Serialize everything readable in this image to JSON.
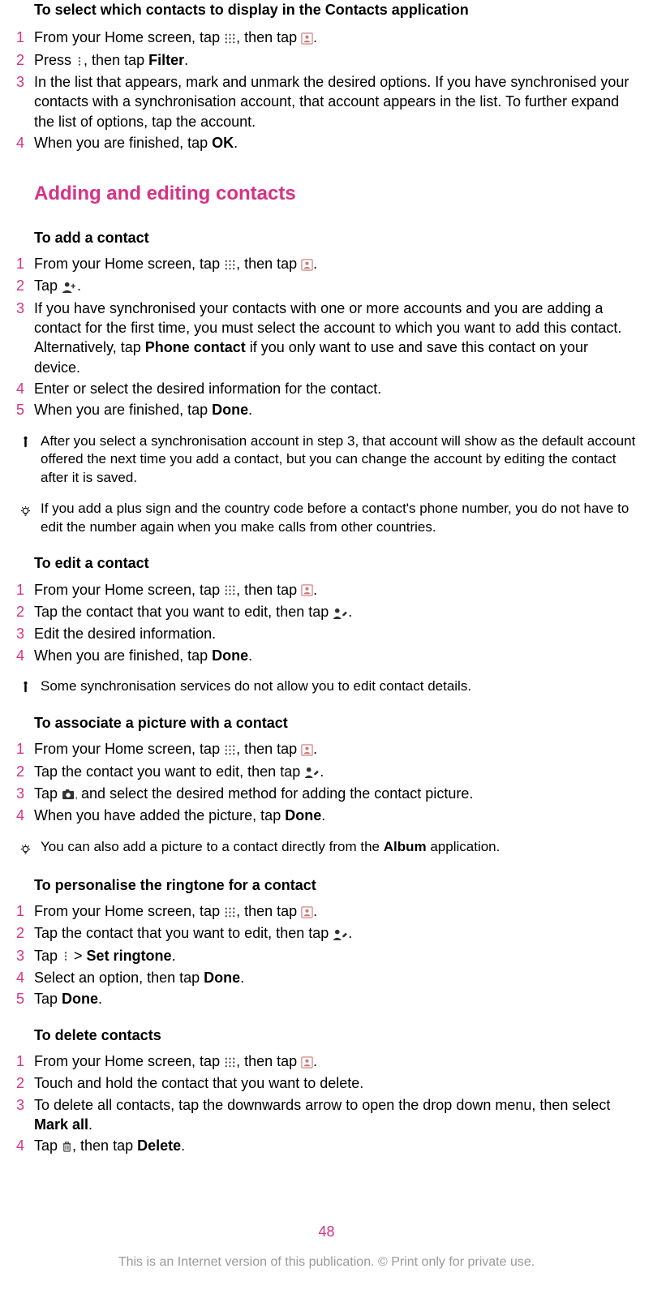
{
  "sec1": {
    "title": "To select which contacts to display in the Contacts application",
    "s1a": "From your Home screen, tap ",
    "s1b": ", then tap ",
    "s1c": ".",
    "s2a": "Press ",
    "s2b": ", then tap ",
    "s2_filter": "Filter",
    "s2c": ".",
    "s3": "In the list that appears, mark and unmark the desired options. If you have synchronised your contacts with a synchronisation account, that account appears in the list. To further expand the list of options, tap the account.",
    "s4a": "When you are finished, tap ",
    "s4_ok": "OK",
    "s4b": "."
  },
  "h2": "Adding and editing contacts",
  "sec2": {
    "title": "To add a contact",
    "s1a": "From your Home screen, tap ",
    "s1b": ", then tap ",
    "s1c": ".",
    "s2a": "Tap ",
    "s2b": ".",
    "s3a": "If you have synchronised your contacts with one or more accounts and you are adding a contact for the first time, you must select the account to which you want to add this contact. Alternatively, tap ",
    "s3_phone": "Phone contact",
    "s3b": " if you only want to use and save this contact on your device.",
    "s4": "Enter or select the desired information for the contact.",
    "s5a": "When you are finished, tap ",
    "s5_done": "Done",
    "s5b": ".",
    "note1": "After you select a synchronisation account in step 3, that account will show as the default account offered the next time you add a contact, but you can change the account by editing the contact after it is saved.",
    "tip1": "If you add a plus sign and the country code before a contact's phone number, you do not have to edit the number again when you make calls from other countries."
  },
  "sec3": {
    "title": "To edit a contact",
    "s1a": "From your Home screen, tap ",
    "s1b": ", then tap ",
    "s1c": ".",
    "s2a": "Tap the contact that you want to edit, then tap ",
    "s2b": ".",
    "s3": "Edit the desired information.",
    "s4a": "When you are finished, tap ",
    "s4_done": "Done",
    "s4b": ".",
    "note1": "Some synchronisation services do not allow you to edit contact details."
  },
  "sec4": {
    "title": "To associate a picture with a contact",
    "s1a": "From your Home screen, tap ",
    "s1b": ", then tap ",
    "s1c": ".",
    "s2a": "Tap the contact you want to edit, then tap ",
    "s2b": ".",
    "s3a": "Tap ",
    "s3b": " and select the desired method for adding the contact picture.",
    "s4a": "When you have added the picture, tap ",
    "s4_done": "Done",
    "s4b": ".",
    "tip1a": "You can also add a picture to a contact directly from the ",
    "tip1_album": "Album",
    "tip1b": " application."
  },
  "sec5": {
    "title": "To personalise the ringtone for a contact",
    "s1a": "From your Home screen, tap ",
    "s1b": ", then tap ",
    "s1c": ".",
    "s2a": "Tap the contact that you want to edit, then tap ",
    "s2b": ".",
    "s3a": "Tap ",
    "s3b": " > ",
    "s3_ring": "Set ringtone",
    "s3c": ".",
    "s4a": "Select an option, then tap ",
    "s4_done": "Done",
    "s4b": ".",
    "s5a": "Tap ",
    "s5_done": "Done",
    "s5b": "."
  },
  "sec6": {
    "title": "To delete contacts",
    "s1a": "From your Home screen, tap ",
    "s1b": ", then tap ",
    "s1c": ".",
    "s2": "Touch and hold the contact that you want to delete.",
    "s3a": "To delete all contacts, tap the downwards arrow to open the drop down menu, then select ",
    "s3_mark": "Mark all",
    "s3b": ".",
    "s4a": "Tap ",
    "s4b": ", then tap ",
    "s4_del": "Delete",
    "s4c": "."
  },
  "footer": {
    "page": "48",
    "text": "This is an Internet version of this publication. © Print only for private use."
  }
}
